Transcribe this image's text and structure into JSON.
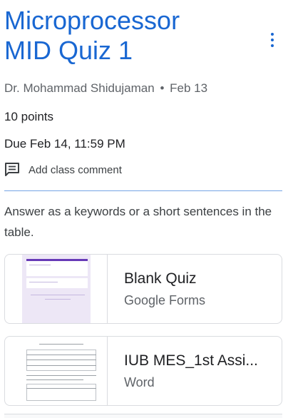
{
  "assignment": {
    "title_line1": "Microprocessor",
    "title_line2": "MID Quiz 1",
    "author": "Dr. Mohammad Shidujaman",
    "separator": "•",
    "posted_date": "Feb 13",
    "points": "10 points",
    "due": "Due Feb 14, 11:59 PM",
    "add_comment_label": "Add class comment",
    "instructions": "Answer as a keywords or a short sentences in the table."
  },
  "attachments": [
    {
      "title": "Blank Quiz",
      "type": "Google Forms",
      "icon": "google-forms-thumbnail"
    },
    {
      "title": "IUB MES_1st Assi...",
      "type": "Word",
      "icon": "word-document-thumbnail"
    }
  ],
  "colors": {
    "accent": "#1967d2",
    "forms_purple": "#673ab7",
    "text_secondary": "#5f6368",
    "border": "#dadce0"
  },
  "icons": {
    "menu": "more-vert-icon",
    "comment": "comment-icon"
  }
}
